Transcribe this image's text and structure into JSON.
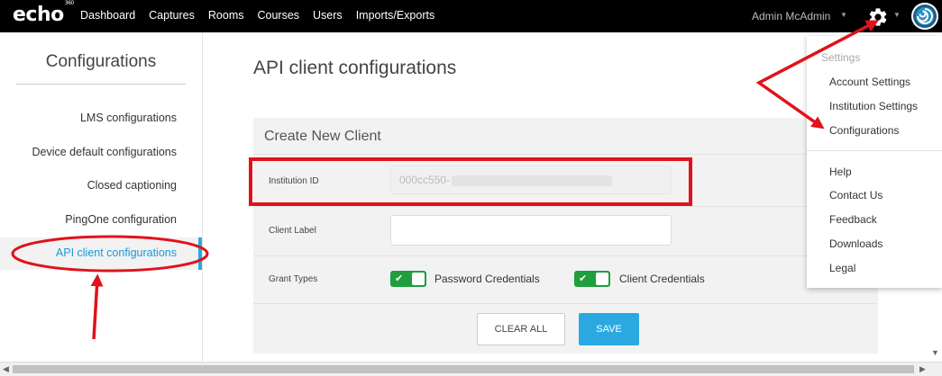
{
  "topnav": {
    "logo": "echo",
    "logo_sup": "360",
    "items": [
      "Dashboard",
      "Captures",
      "Rooms",
      "Courses",
      "Users",
      "Imports/Exports"
    ],
    "user_name": "Admin McAdmin"
  },
  "sidebar": {
    "title": "Configurations",
    "items": [
      {
        "label": "LMS configurations"
      },
      {
        "label": "Device default configurations"
      },
      {
        "label": "Closed captioning"
      },
      {
        "label": "PingOne configuration"
      },
      {
        "label": "API client configurations",
        "active": true
      }
    ]
  },
  "main": {
    "title": "API client configurations",
    "panel_title": "Create New Client",
    "institution_id_label": "Institution ID",
    "institution_id_value": "000cc550-",
    "client_label_label": "Client Label",
    "client_label_value": "",
    "grant_types_label": "Grant Types",
    "grants": [
      {
        "label": "Password Credentials",
        "enabled": true
      },
      {
        "label": "Client Credentials",
        "enabled": true
      }
    ],
    "clear_button": "CLEAR ALL",
    "save_button": "SAVE"
  },
  "dropdown": {
    "heading": "Settings",
    "items": [
      "Account Settings",
      "Institution Settings",
      "Configurations"
    ],
    "items2": [
      "Help",
      "Contact Us",
      "Feedback",
      "Downloads",
      "Legal"
    ]
  },
  "colors": {
    "topbar": "#000000",
    "accent": "#2aa9e0",
    "toggle_on": "#1f9e3e",
    "annotation_red": "#e0121b"
  },
  "icons": {
    "settings": "gear-icon",
    "caret": "caret-down-icon",
    "avatar": "swirl-avatar-icon",
    "check": "check-icon"
  }
}
